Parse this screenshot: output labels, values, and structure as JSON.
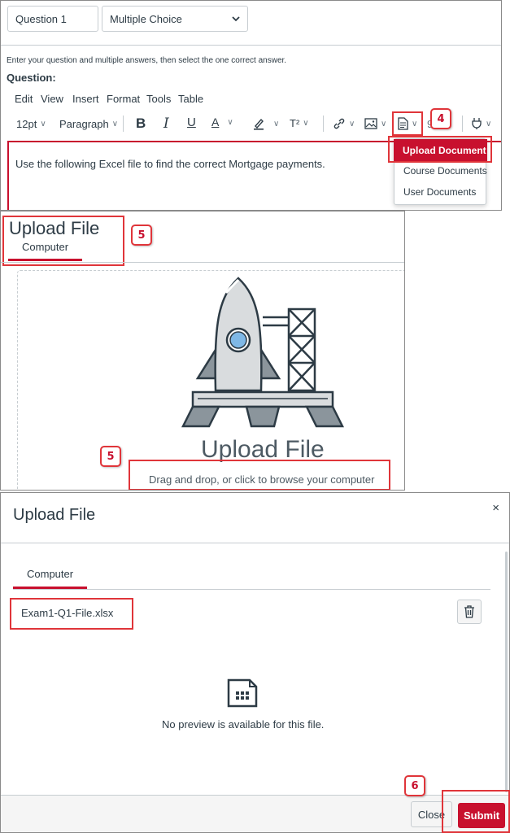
{
  "question_editor": {
    "question_name_value": "Question 1",
    "question_type_value": "Multiple Choice",
    "instructions": "Enter your question and multiple answers, then select the one correct answer.",
    "question_label": "Question:",
    "menubar": [
      "Edit",
      "View",
      "Insert",
      "Format",
      "Tools",
      "Table"
    ],
    "toolbar": {
      "font_size": "12pt",
      "block_format": "Paragraph",
      "bold": "B",
      "italic": "I",
      "underline": "U",
      "text_color": "A",
      "superscript": "T²"
    },
    "body_text": "Use the following Excel file to find the correct Mortgage payments.",
    "document_menu": [
      "Upload Document",
      "Course Documents",
      "User Documents"
    ],
    "callout_4": "4"
  },
  "upload_panel": {
    "title": "Upload File",
    "tab": "Computer",
    "callout_5a": "5",
    "drop_title": "Upload File",
    "drop_hint": "Drag and drop, or click to browse your computer",
    "callout_5b": "5"
  },
  "upload_dialog": {
    "title": "Upload File",
    "close_glyph": "×",
    "tab": "Computer",
    "file_name": "Exam1-Q1-File.xlsx",
    "no_preview": "No preview is available for this file.",
    "close_label": "Close",
    "submit_label": "Submit",
    "callout_6": "6"
  },
  "colors": {
    "brand": "#c8102e",
    "annotation": "#e0353a",
    "text": "#2d3b45",
    "border": "#c7cdd1"
  },
  "icons": [
    "chevron-down-icon",
    "link-icon",
    "image-icon",
    "document-icon",
    "plug-icon",
    "rocket-launch-illustration",
    "trash-icon",
    "file-grid-icon",
    "close-icon"
  ]
}
